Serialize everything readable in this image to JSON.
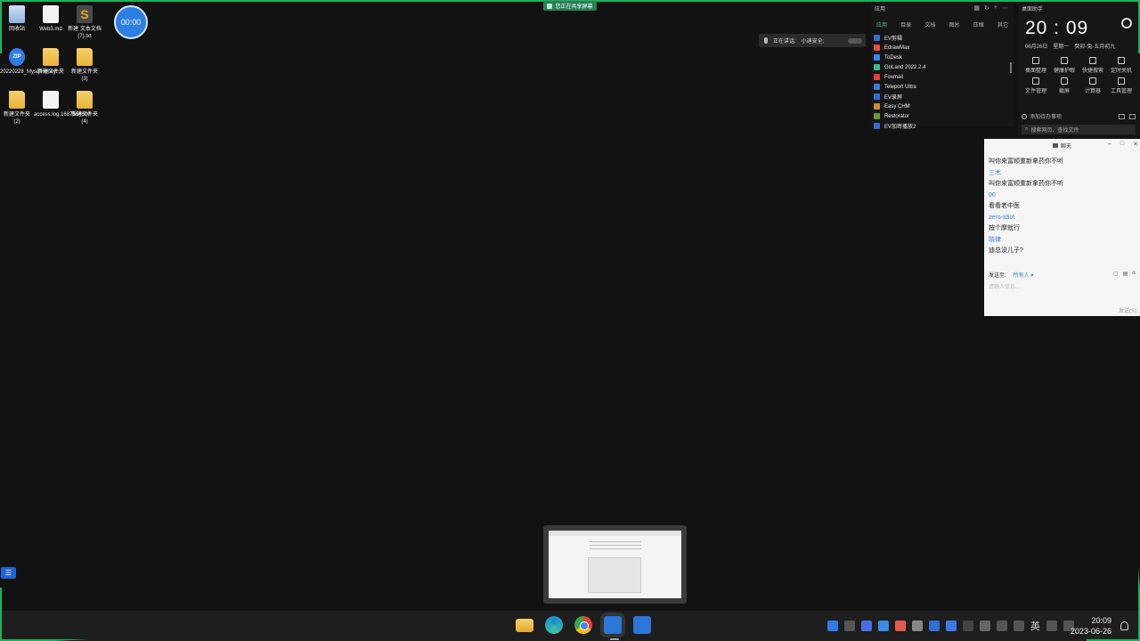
{
  "share_banner": "您正在共享屏幕",
  "timer": "00:00",
  "desktop_icons": [
    {
      "label": "回收站",
      "type": "bin"
    },
    {
      "label": "Web3.md",
      "type": "doc"
    },
    {
      "label": "新建 文本文档 (7).txt",
      "type": "sublime"
    },
    {
      "label": "20220228_MysqlHoney...",
      "type": "zip"
    },
    {
      "label": "新建文件夹",
      "type": "folder"
    },
    {
      "label": "新建文件夹 (3)",
      "type": "folder"
    },
    {
      "label": "新建文件夹 (2)",
      "type": "folder"
    },
    {
      "label": "access.log.1687564800",
      "type": "doc"
    },
    {
      "label": "新建文件夹 (4)",
      "type": "folder"
    }
  ],
  "speaking": {
    "label": "正在讲话:",
    "name": "小迪安全;"
  },
  "apps_panel": {
    "title": "应用",
    "tabs": [
      "应用",
      "目录",
      "文档",
      "图片",
      "压缩",
      "其它"
    ],
    "apps": [
      {
        "name": "EV剪辑",
        "color": "#2f6fd6"
      },
      {
        "name": "EdrawMax",
        "color": "#e94e3c"
      },
      {
        "name": "ToDesk",
        "color": "#2f8ae8"
      },
      {
        "name": "GoLand 2022.2.4",
        "color": "#3bb88f"
      },
      {
        "name": "Foxmail",
        "color": "#e8422f"
      },
      {
        "name": "Teleport Ultra",
        "color": "#3a7bd5"
      },
      {
        "name": "EV录屏",
        "color": "#2f6fd6"
      },
      {
        "name": "Easy CHM",
        "color": "#c88f2a"
      },
      {
        "name": "Restorator",
        "color": "#6a9a3a"
      },
      {
        "name": "EV加密播放2",
        "color": "#2f6fd6"
      }
    ]
  },
  "assistant": {
    "title": "桌面助手",
    "time": "20 : 09",
    "date": "06月26日",
    "weekday": "星期一",
    "lunar": "癸卯-兔-五月初九",
    "tools": [
      "桌面整理",
      "健康护眼",
      "快捷搜索",
      "定时关机",
      "文件管理",
      "截屏",
      "计算器",
      "工具管理"
    ],
    "todo": "添加待办事项",
    "search_placeholder": "搜索网页、查找文件"
  },
  "chat": {
    "title": "聊天",
    "messages": [
      {
        "text": "叫你来富顺重新拿药你不听",
        "kind": "msg"
      },
      {
        "text": "三木",
        "kind": "name"
      },
      {
        "text": "叫你来富顺重新拿药你不听",
        "kind": "msg"
      },
      {
        "text": "00",
        "kind": "name"
      },
      {
        "text": "看看老中医",
        "kind": "msg"
      },
      {
        "text": "zero-Idiot",
        "kind": "name"
      },
      {
        "text": "按个摩就行",
        "kind": "msg"
      },
      {
        "text": "晓律",
        "kind": "name"
      },
      {
        "text": "迪总没儿子?",
        "kind": "msg"
      }
    ],
    "send_to_label": "发送至:",
    "send_to_value": "所有人 ▾",
    "input_placeholder": "请输入信息...",
    "send_button": "发送(S)"
  },
  "taskbar": {
    "tray_lang": "英",
    "clock_time": "20:09",
    "clock_date": "2023-06-26"
  }
}
